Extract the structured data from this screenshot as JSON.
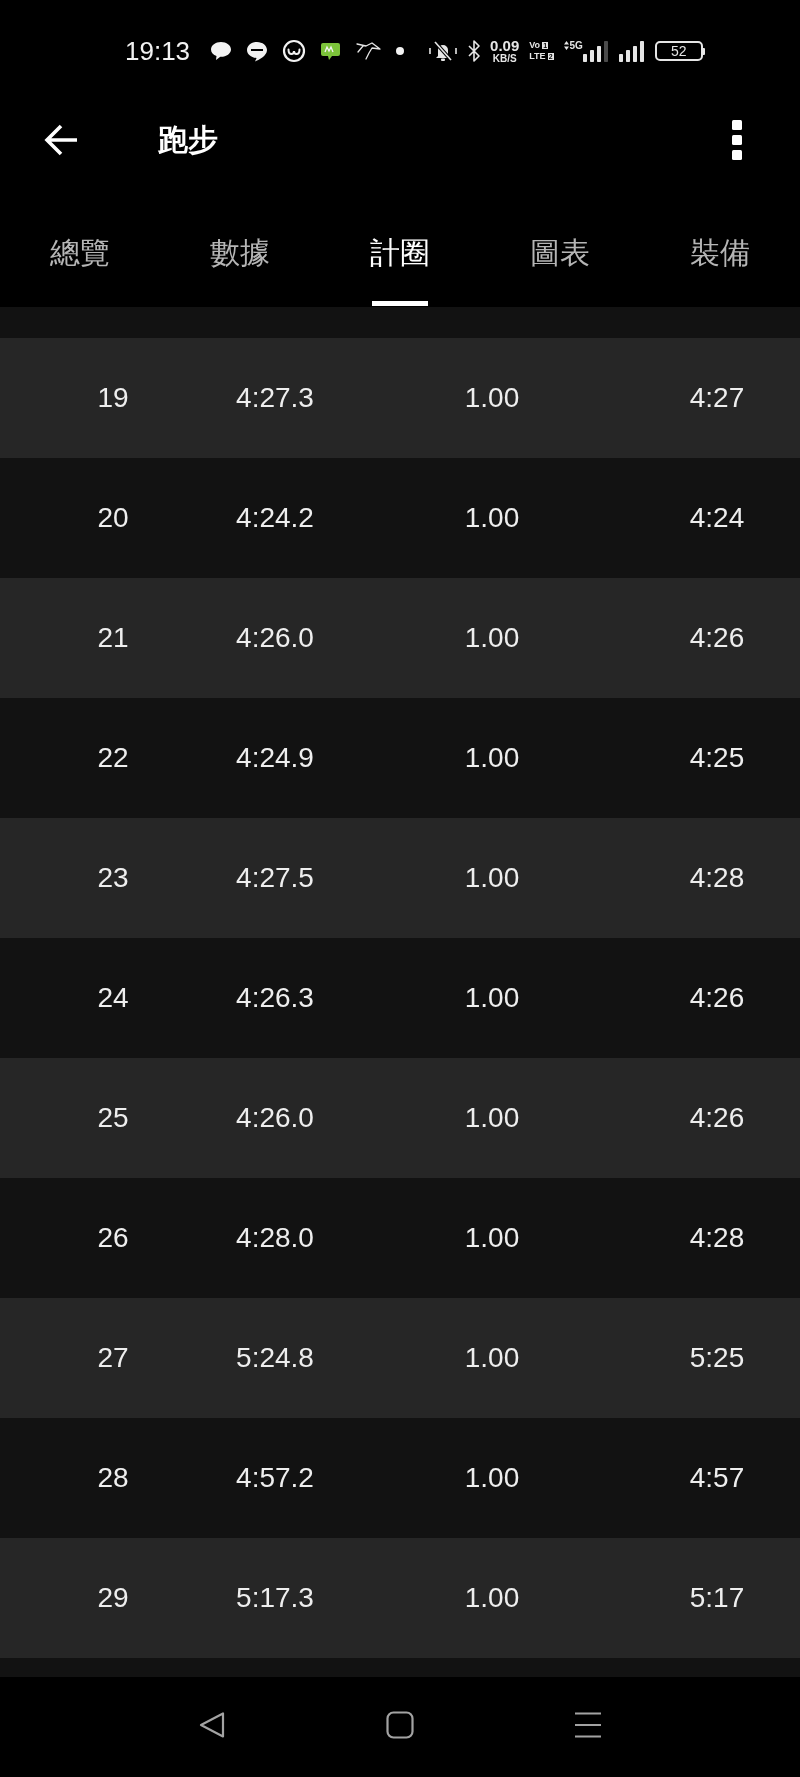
{
  "status_bar": {
    "time": "19:13",
    "network_speed": "0.09",
    "network_speed_unit": "KB/S",
    "volte": "Vo",
    "lte": "LTE",
    "sim_1": "1",
    "sim_2": "2",
    "network_type": "5G",
    "battery": "52"
  },
  "header": {
    "title": "跑步"
  },
  "tabs": [
    {
      "label": "總覽",
      "selected": false
    },
    {
      "label": "數據",
      "selected": false
    },
    {
      "label": "計圈",
      "selected": true
    },
    {
      "label": "圖表",
      "selected": false
    },
    {
      "label": "裝備",
      "selected": false
    }
  ],
  "laps": [
    {
      "lap": "19",
      "time": "4:27.3",
      "distance": "1.00",
      "pace": "4:27"
    },
    {
      "lap": "20",
      "time": "4:24.2",
      "distance": "1.00",
      "pace": "4:24"
    },
    {
      "lap": "21",
      "time": "4:26.0",
      "distance": "1.00",
      "pace": "4:26"
    },
    {
      "lap": "22",
      "time": "4:24.9",
      "distance": "1.00",
      "pace": "4:25"
    },
    {
      "lap": "23",
      "time": "4:27.5",
      "distance": "1.00",
      "pace": "4:28"
    },
    {
      "lap": "24",
      "time": "4:26.3",
      "distance": "1.00",
      "pace": "4:26"
    },
    {
      "lap": "25",
      "time": "4:26.0",
      "distance": "1.00",
      "pace": "4:26"
    },
    {
      "lap": "26",
      "time": "4:28.0",
      "distance": "1.00",
      "pace": "4:28"
    },
    {
      "lap": "27",
      "time": "5:24.8",
      "distance": "1.00",
      "pace": "5:25"
    },
    {
      "lap": "28",
      "time": "4:57.2",
      "distance": "1.00",
      "pace": "4:57"
    },
    {
      "lap": "29",
      "time": "5:17.3",
      "distance": "1.00",
      "pace": "5:17"
    }
  ]
}
